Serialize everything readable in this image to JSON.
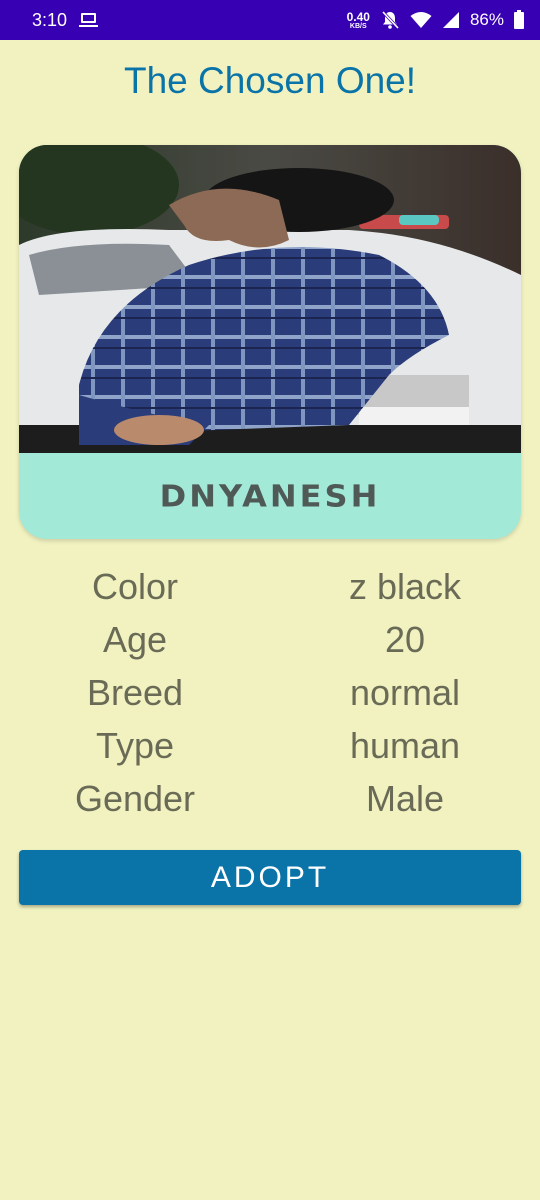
{
  "status_bar": {
    "time": "3:10",
    "net_speed_value": "0.40",
    "net_speed_unit": "KB/S",
    "battery": "86%",
    "icons": [
      "laptop-icon",
      "bell-off-icon",
      "wifi-icon",
      "signal-icon",
      "battery-icon"
    ]
  },
  "title": "The Chosen One!",
  "card": {
    "photo": "person-photo",
    "name": "DNYANESH"
  },
  "details": [
    {
      "label": "Color",
      "value": "z black"
    },
    {
      "label": "Age",
      "value": "20"
    },
    {
      "label": "Breed",
      "value": "normal"
    },
    {
      "label": "Type",
      "value": "human"
    },
    {
      "label": "Gender",
      "value": "Male"
    }
  ],
  "adopt_label": "ADOPT",
  "colors": {
    "status_bar": "#3700b3",
    "background": "#f1f2c0",
    "accent": "#0a73a8",
    "card_band": "#a3e9d8"
  }
}
